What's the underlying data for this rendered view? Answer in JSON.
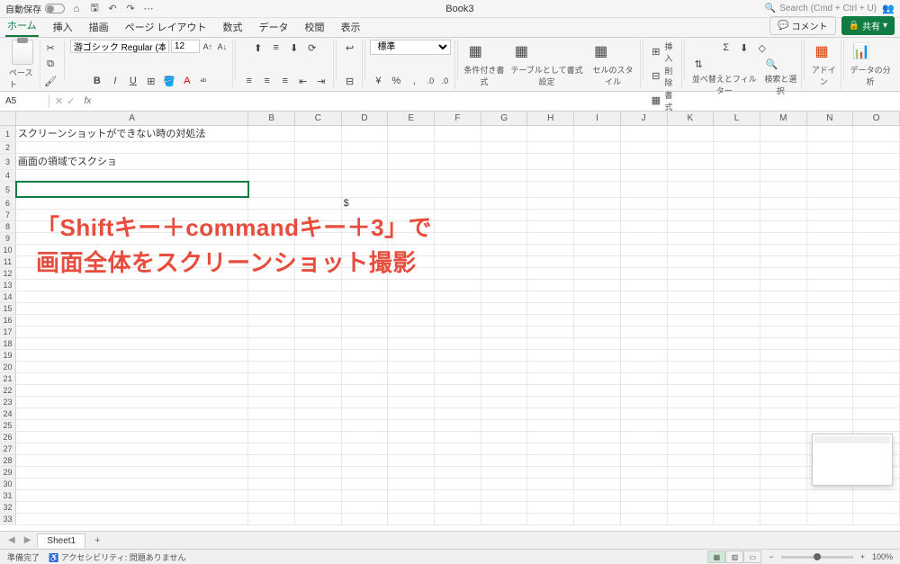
{
  "titlebar": {
    "autosave": "自動保存",
    "title": "Book3",
    "search_placeholder": "Search (Cmd + Ctrl + U)"
  },
  "tabs": {
    "items": [
      "ホーム",
      "挿入",
      "描画",
      "ページ レイアウト",
      "数式",
      "データ",
      "校閲",
      "表示"
    ],
    "active": 0,
    "comment": "コメント",
    "share": "共有"
  },
  "ribbon": {
    "paste": "ペースト",
    "font_name": "游ゴシック Regular (本文)",
    "font_size": "12",
    "number_format": "標準",
    "cond_fmt": "条件付き書式",
    "table_fmt": "テーブルとして書式設定",
    "cell_style": "セルのスタイル",
    "insert": "挿入",
    "delete": "削除",
    "format": "書式",
    "sort": "並べ替えとフィルター",
    "find": "検索と選択",
    "addins": "アドイン",
    "analysis": "データの分析"
  },
  "formula": {
    "name": "A5",
    "fx": "fx"
  },
  "columns": [
    "A",
    "B",
    "C",
    "D",
    "E",
    "F",
    "G",
    "H",
    "I",
    "J",
    "K",
    "L",
    "M",
    "N",
    "O"
  ],
  "cells": {
    "A1": "スクリーンショットができない時の対処法",
    "A3": "画面の領域でスクショ",
    "D6": "$"
  },
  "overlay": {
    "line1": "「Shiftキー＋commandキー＋3」で",
    "line2": "画面全体をスクリーンショット撮影"
  },
  "sheets": {
    "tab": "Sheet1"
  },
  "status": {
    "ready": "準備完了",
    "a11y": "アクセシビリティ: 問題ありません",
    "zoom": "100%"
  }
}
